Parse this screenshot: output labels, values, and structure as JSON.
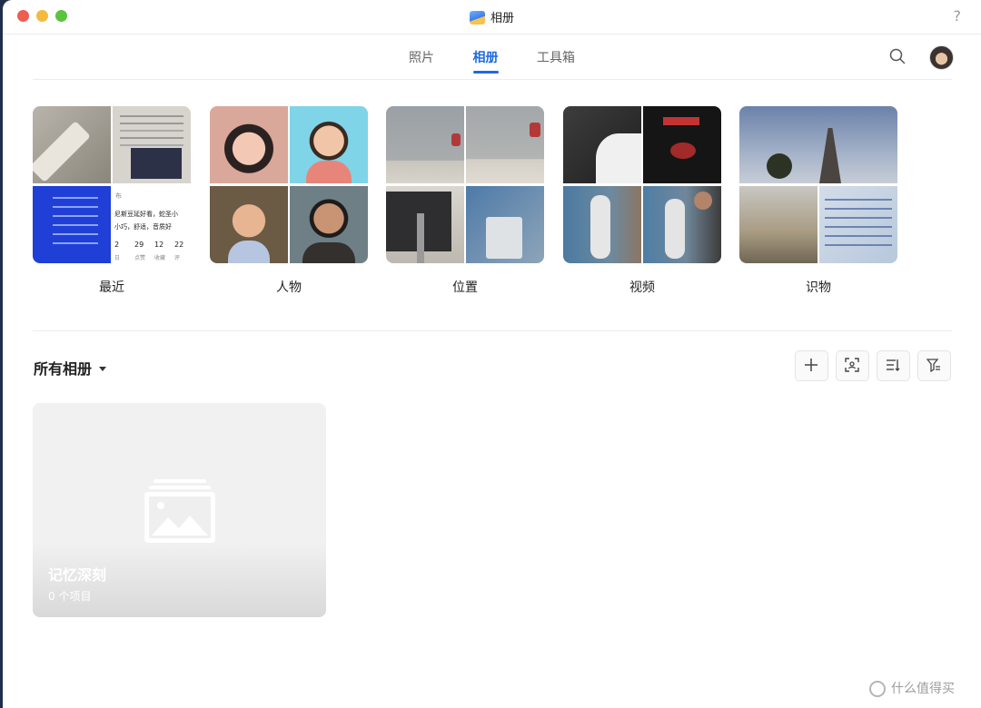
{
  "window": {
    "title": "相册",
    "help": "?"
  },
  "tabs": [
    {
      "label": "照片",
      "active": false
    },
    {
      "label": "相册",
      "active": true
    },
    {
      "label": "工具箱",
      "active": false
    }
  ],
  "accent_color": "#1f6ae0",
  "categories": [
    {
      "label": "最近"
    },
    {
      "label": "人物"
    },
    {
      "label": "位置"
    },
    {
      "label": "视频"
    },
    {
      "label": "识物"
    }
  ],
  "recent_thumb_text": {
    "line1": "尼斯豆延好看，蛇圣小",
    "line2": "小巧，舒适，音质好",
    "stats": [
      "2",
      "29",
      "12",
      "22"
    ],
    "stat_labels": [
      "日",
      "点赞",
      "收藏",
      "评"
    ],
    "tag": "布"
  },
  "all_albums": {
    "title": "所有相册",
    "tools": [
      "add-icon",
      "scan-icon",
      "sort-icon",
      "filter-icon"
    ]
  },
  "albums": [
    {
      "name": "记忆深刻",
      "count": "0 个项目"
    }
  ],
  "watermark": "什么值得买"
}
